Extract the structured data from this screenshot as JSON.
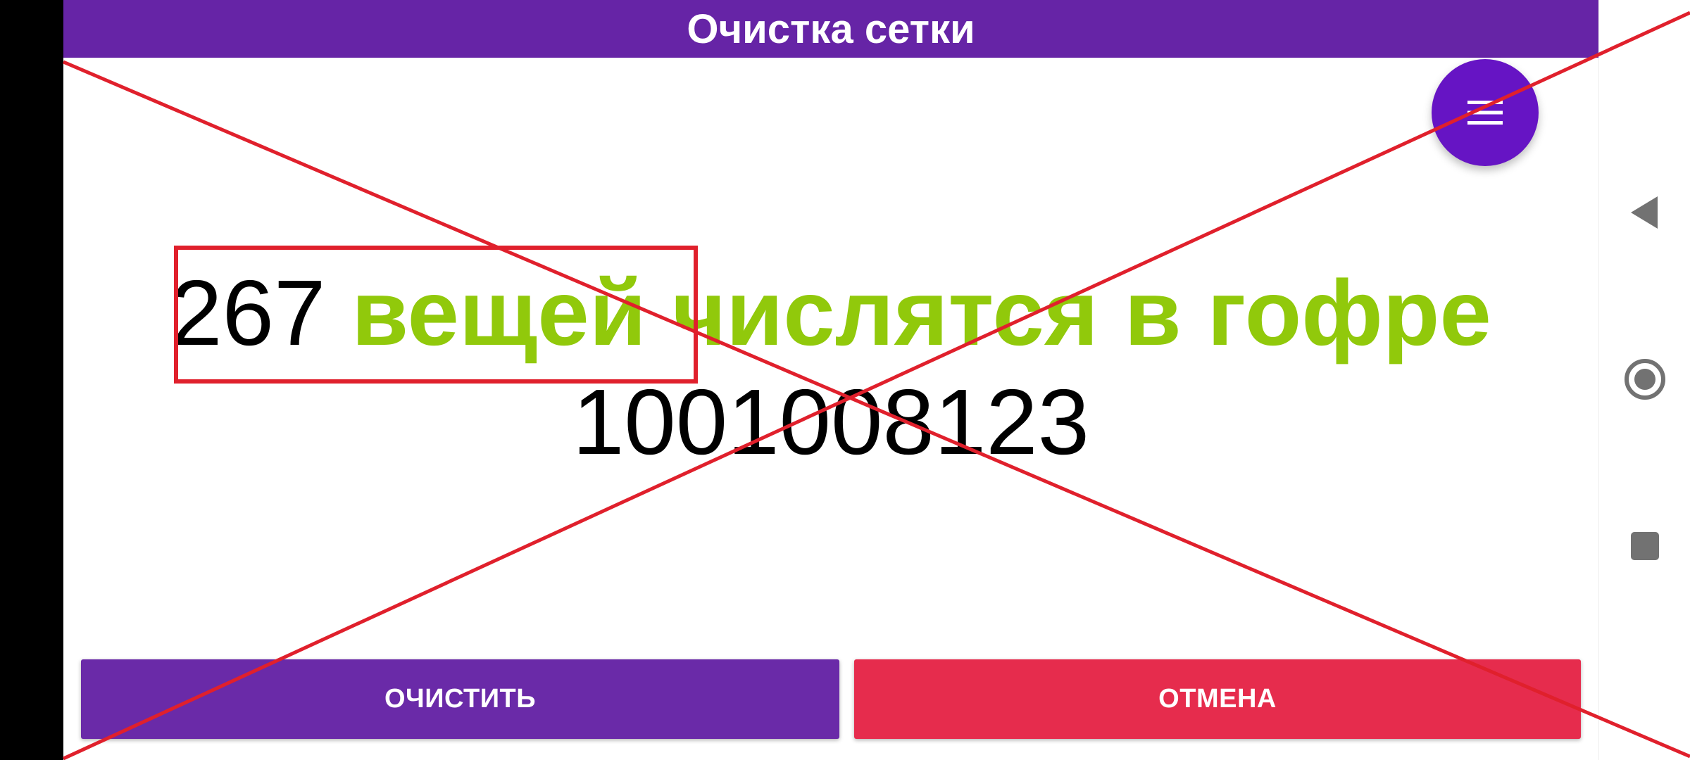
{
  "app": {
    "title": "Очистка сетки"
  },
  "fab": {
    "icon": "menu-icon"
  },
  "content": {
    "count": "267",
    "message": "вещей числятся в гофре",
    "code": "1001008123"
  },
  "actions": {
    "clear_label": "ОЧИСТИТЬ",
    "cancel_label": "ОТМЕНА"
  },
  "nav": {
    "back_icon": "back-triangle-icon",
    "home_icon": "home-circle-icon",
    "recents_icon": "recents-square-icon"
  },
  "colors": {
    "title_bar": "#6624a6",
    "fab": "#6614c4",
    "message_green": "#91c90b",
    "clear_button": "#6a2aa8",
    "cancel_button": "#e62c4d",
    "annotation_red": "#e0202c"
  }
}
